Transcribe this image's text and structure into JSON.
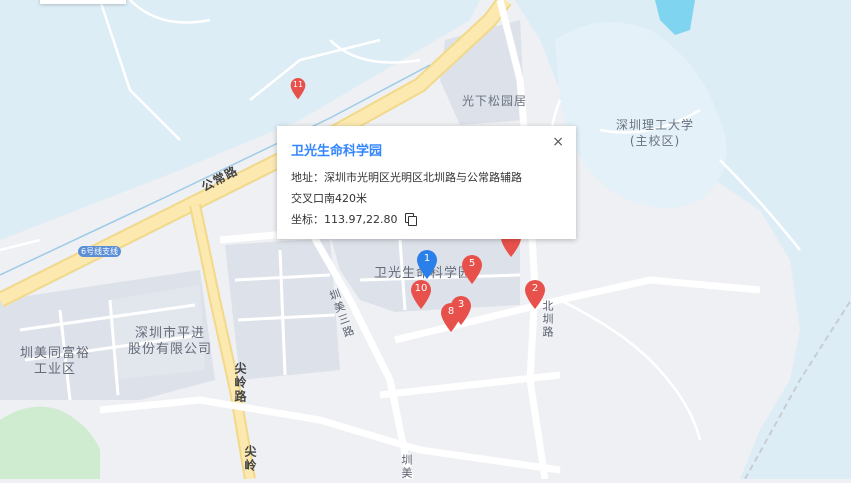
{
  "popup": {
    "title": "卫光生命科学园",
    "address_line1": "地址：深圳市光明区光明区北圳路与公常路辅路",
    "address_line2": "交叉口南420米",
    "coords_label": "坐标：113.97,22.80",
    "close_label": "×"
  },
  "labels": {
    "gongchang_road": "公常路",
    "gongchang_road_2": "公常路",
    "guangxia_songyuan": "光下松园居",
    "university_line1": "深圳理工大学",
    "university_line2": "(主校区)",
    "metro_line": "6号线支线",
    "weiguang_park": "卫光生命科学园",
    "jianmei_road": "圳美三路",
    "beizhen_road": "北圳路",
    "pingjin_line1": "深圳市平进",
    "pingjin_line2": "股份有限公司",
    "fuyu_line1": "圳美同富裕",
    "fuyu_line2": "工业区",
    "jianling_road": "尖岭路",
    "jianling_road_2": "尖岭",
    "zhenmei_road_lower": "圳美"
  },
  "markers": [
    {
      "id": "m1",
      "label": "1",
      "color": "blue"
    },
    {
      "id": "m2",
      "label": "2",
      "color": "red"
    },
    {
      "id": "m5",
      "label": "5",
      "color": "red"
    },
    {
      "id": "m10",
      "label": "10",
      "color": "red"
    },
    {
      "id": "m8",
      "label": "8",
      "color": "red"
    },
    {
      "id": "m3",
      "label": "3",
      "color": "red"
    },
    {
      "id": "m11",
      "label": "11",
      "color": "red"
    },
    {
      "id": "m-top",
      "label": "",
      "color": "red"
    }
  ],
  "colors": {
    "water": "#d8ecf7",
    "green": "#cbeac8",
    "block": "#dfe3ea",
    "road": "#ffffff",
    "highway": "#f9e6a6",
    "marker_red": "#e8514b",
    "marker_blue": "#2b7fe8",
    "popup_title": "#3385ff"
  }
}
